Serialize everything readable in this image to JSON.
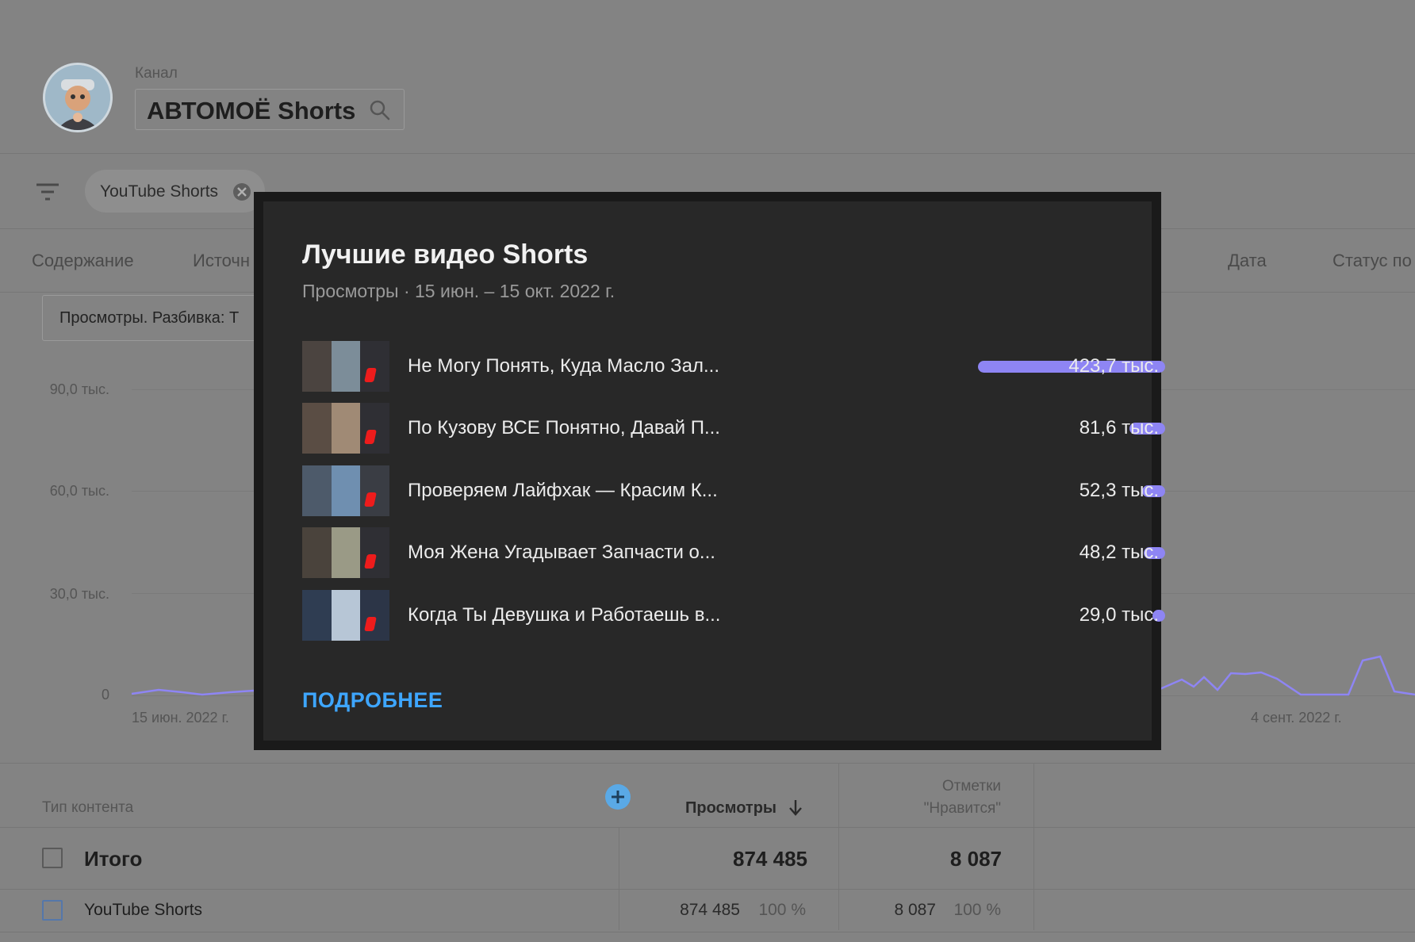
{
  "header": {
    "channel_caption": "Канал",
    "channel_name": "АВТОМОЁ Shorts"
  },
  "filter": {
    "chip_label": "YouTube Shorts"
  },
  "tabs": [
    "Содержание",
    "Источн",
    "Дата",
    "Статус по"
  ],
  "breakdown": {
    "label": "Просмотры. Разбивка: Т"
  },
  "chart": {
    "y_ticks": [
      "90,0 тыс.",
      "60,0 тыс.",
      "30,0 тыс.",
      "0"
    ],
    "x_labels": [
      "15 июн. 2022 г.",
      "4 сент. 2022 г."
    ],
    "line_color": "#8e85f4"
  },
  "popup": {
    "title": "Лучшие видео Shorts",
    "subtitle": "Просмотры · 15 июн. – 15 окт. 2022 г.",
    "more_link": "ПОДРОБНЕЕ",
    "bar_color": "#8e85f4",
    "items": [
      {
        "title": "Не Могу Понять, Куда Масло Зал...",
        "value_label": "423,7 тыс.",
        "value": 423.7
      },
      {
        "title": "По Кузову ВСЕ Понятно, Давай П...",
        "value_label": "81,6 тыс.",
        "value": 81.6
      },
      {
        "title": "Проверяем Лайфхак — Красим К...",
        "value_label": "52,3 тыс.",
        "value": 52.3
      },
      {
        "title": "Моя Жена Угадывает Запчасти о...",
        "value_label": "48,2 тыс.",
        "value": 48.2
      },
      {
        "title": "Когда Ты Девушка и Работаешь в...",
        "value_label": "29,0 тыс.",
        "value": 29.0
      }
    ]
  },
  "table": {
    "col_content_type": "Тип контента",
    "col_views": "Просмотры",
    "col_likes_line1": "Отметки",
    "col_likes_line2": "\"Нравится\"",
    "total_row": {
      "label": "Итого",
      "views": "874 485",
      "likes": "8 087"
    },
    "rows": [
      {
        "label": "YouTube Shorts",
        "views": "874 485",
        "views_pct": "100 %",
        "likes": "8 087",
        "likes_pct": "100 %"
      }
    ]
  }
}
